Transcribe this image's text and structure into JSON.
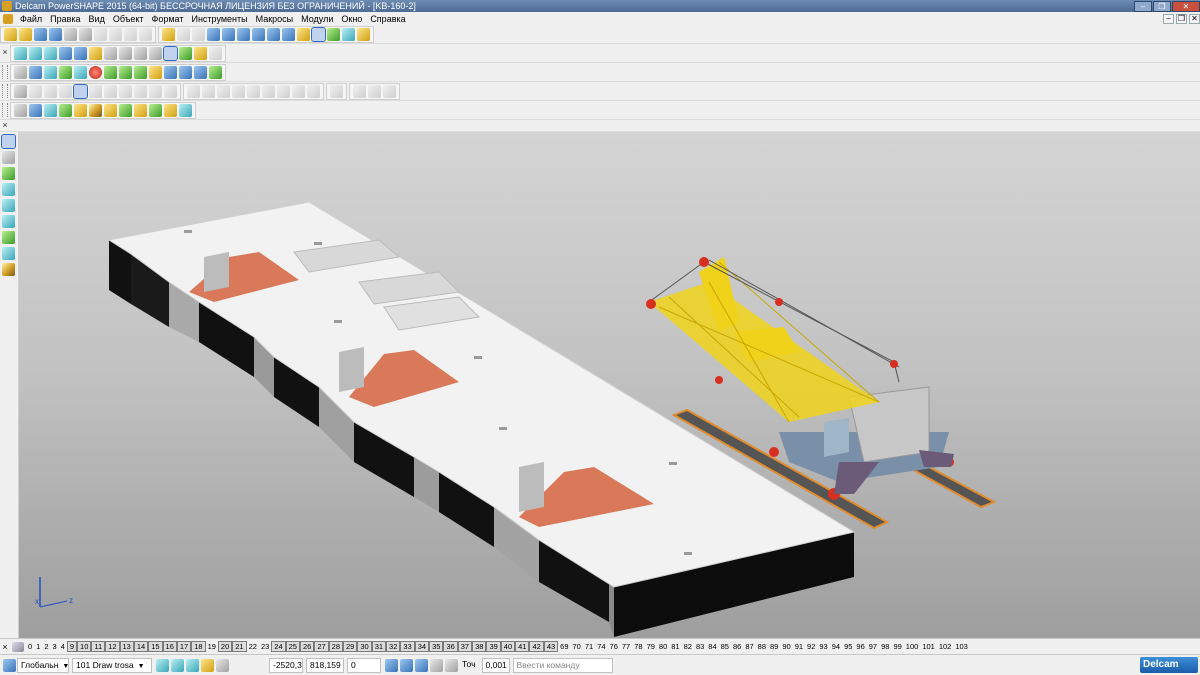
{
  "window": {
    "title": "Delcam PowerSHAPE 2015 (64-bit) БЕССРОЧНАЯ ЛИЦЕНЗИЯ БЕЗ ОГРАНИЧЕНИЙ - [KB-160-2]",
    "minimize": "–",
    "restore": "❐",
    "close": "✕"
  },
  "menu": {
    "items": [
      "Файл",
      "Правка",
      "Вид",
      "Объект",
      "Формат",
      "Инструменты",
      "Макросы",
      "Модули",
      "Окно",
      "Справка"
    ]
  },
  "levels": {
    "numbers": [
      "0",
      "1",
      "2",
      "3",
      "4",
      "9",
      "10",
      "11",
      "12",
      "13",
      "14",
      "15",
      "16",
      "17",
      "18",
      "19",
      "20",
      "21",
      "22",
      "23",
      "24",
      "25",
      "26",
      "27",
      "28",
      "29",
      "30",
      "31",
      "32",
      "33",
      "34",
      "35",
      "36",
      "37",
      "38",
      "39",
      "40",
      "41",
      "42",
      "43",
      "69",
      "70",
      "71",
      "74",
      "76",
      "77",
      "78",
      "79",
      "80",
      "81",
      "82",
      "83",
      "84",
      "85",
      "86",
      "87",
      "88",
      "89",
      "90",
      "91",
      "92",
      "93",
      "94",
      "95",
      "96",
      "97",
      "98",
      "99",
      "100",
      "101",
      "102",
      "103"
    ],
    "boxed": [
      "9",
      "10",
      "11",
      "12",
      "13",
      "14",
      "15",
      "16",
      "17",
      "18",
      "20",
      "21",
      "24",
      "25",
      "26",
      "27",
      "28",
      "29",
      "30",
      "31",
      "32",
      "33",
      "34",
      "35",
      "36",
      "37",
      "38",
      "39",
      "40",
      "41",
      "42",
      "43"
    ]
  },
  "status": {
    "workplane": "Глобальн",
    "level": "101",
    "level_name": "Draw trosa",
    "x": "-2520,3",
    "y": "818,159",
    "z": "0",
    "tolerance_label": "Точ",
    "tolerance": "0,001",
    "command_placeholder": "Ввести команду",
    "logo": "Delcam"
  },
  "axis": {
    "x": "x",
    "z": "z"
  },
  "colors": {
    "slab": "#f2f2f2",
    "wall_dark": "#111111",
    "wall_grey": "#a9a9a9",
    "orange_floor": "#d9795a",
    "crane_yellow": "#f0d21a",
    "crane_red": "#d83020",
    "rail_orange": "#e08a2c"
  },
  "icons": [
    "app-icon",
    "select-arrow-icon",
    "open-folder-icon",
    "save-icon",
    "print-icon",
    "cut-icon",
    "copy-icon",
    "paste-icon",
    "undo-icon",
    "redo-icon",
    "line-icon",
    "arc-icon",
    "circle-icon",
    "curve-icon",
    "solid-icon",
    "surface-icon",
    "shaded-view-icon",
    "wireframe-view-icon",
    "iso-view-icon",
    "zoom-icon",
    "grid-icon"
  ]
}
